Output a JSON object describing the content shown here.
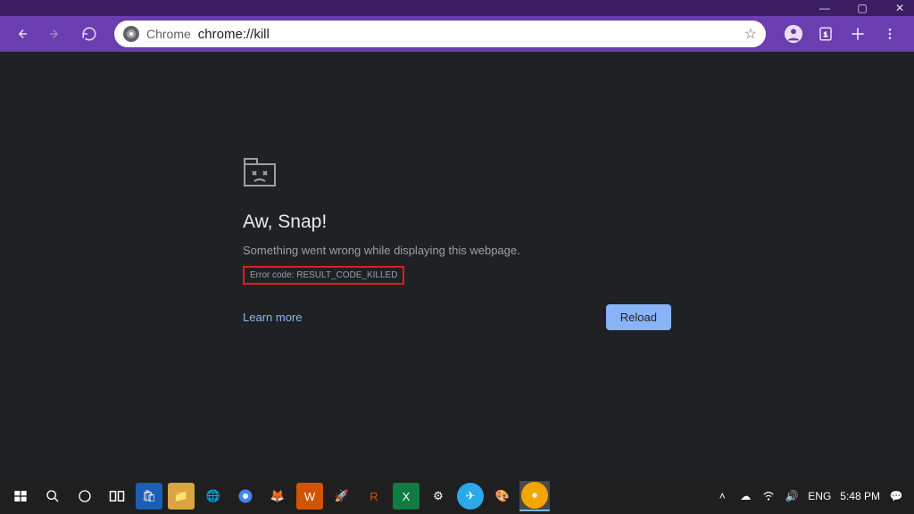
{
  "window": {
    "minimize": "—",
    "maximize": "▢",
    "close": "✕"
  },
  "toolbar": {
    "chrome_label": "Chrome",
    "url": "chrome://kill"
  },
  "error": {
    "title": "Aw, Snap!",
    "message": "Something went wrong while displaying this webpage.",
    "code": "Error code: RESULT_CODE_KILLED",
    "learn_more": "Learn more",
    "reload": "Reload"
  },
  "taskbar": {
    "lang": "ENG",
    "time": "5:48 PM"
  }
}
